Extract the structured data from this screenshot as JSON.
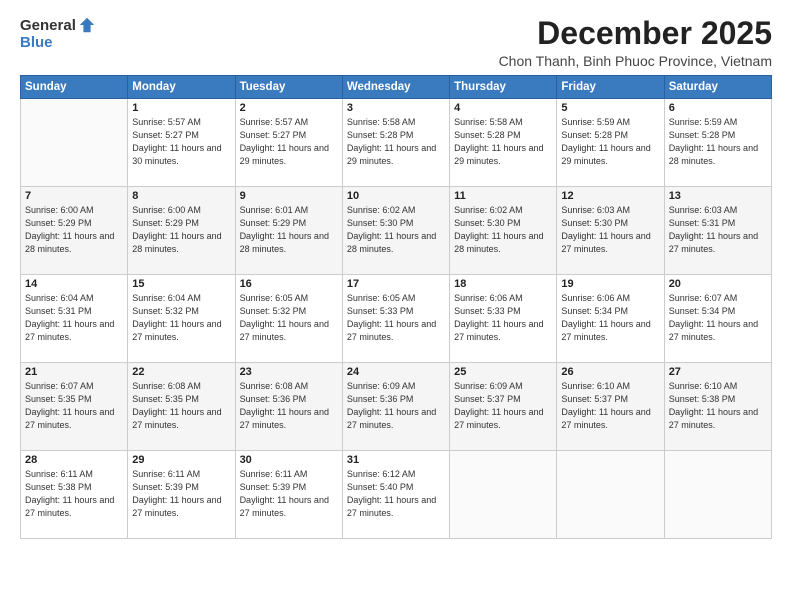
{
  "logo": {
    "general": "General",
    "blue": "Blue"
  },
  "title": "December 2025",
  "subtitle": "Chon Thanh, Binh Phuoc Province, Vietnam",
  "days_of_week": [
    "Sunday",
    "Monday",
    "Tuesday",
    "Wednesday",
    "Thursday",
    "Friday",
    "Saturday"
  ],
  "weeks": [
    [
      {
        "day": "",
        "info": ""
      },
      {
        "day": "1",
        "info": "Sunrise: 5:57 AM\nSunset: 5:27 PM\nDaylight: 11 hours\nand 30 minutes."
      },
      {
        "day": "2",
        "info": "Sunrise: 5:57 AM\nSunset: 5:27 PM\nDaylight: 11 hours\nand 29 minutes."
      },
      {
        "day": "3",
        "info": "Sunrise: 5:58 AM\nSunset: 5:28 PM\nDaylight: 11 hours\nand 29 minutes."
      },
      {
        "day": "4",
        "info": "Sunrise: 5:58 AM\nSunset: 5:28 PM\nDaylight: 11 hours\nand 29 minutes."
      },
      {
        "day": "5",
        "info": "Sunrise: 5:59 AM\nSunset: 5:28 PM\nDaylight: 11 hours\nand 29 minutes."
      },
      {
        "day": "6",
        "info": "Sunrise: 5:59 AM\nSunset: 5:28 PM\nDaylight: 11 hours\nand 28 minutes."
      }
    ],
    [
      {
        "day": "7",
        "info": "Sunrise: 6:00 AM\nSunset: 5:29 PM\nDaylight: 11 hours\nand 28 minutes."
      },
      {
        "day": "8",
        "info": "Sunrise: 6:00 AM\nSunset: 5:29 PM\nDaylight: 11 hours\nand 28 minutes."
      },
      {
        "day": "9",
        "info": "Sunrise: 6:01 AM\nSunset: 5:29 PM\nDaylight: 11 hours\nand 28 minutes."
      },
      {
        "day": "10",
        "info": "Sunrise: 6:02 AM\nSunset: 5:30 PM\nDaylight: 11 hours\nand 28 minutes."
      },
      {
        "day": "11",
        "info": "Sunrise: 6:02 AM\nSunset: 5:30 PM\nDaylight: 11 hours\nand 28 minutes."
      },
      {
        "day": "12",
        "info": "Sunrise: 6:03 AM\nSunset: 5:30 PM\nDaylight: 11 hours\nand 27 minutes."
      },
      {
        "day": "13",
        "info": "Sunrise: 6:03 AM\nSunset: 5:31 PM\nDaylight: 11 hours\nand 27 minutes."
      }
    ],
    [
      {
        "day": "14",
        "info": "Sunrise: 6:04 AM\nSunset: 5:31 PM\nDaylight: 11 hours\nand 27 minutes."
      },
      {
        "day": "15",
        "info": "Sunrise: 6:04 AM\nSunset: 5:32 PM\nDaylight: 11 hours\nand 27 minutes."
      },
      {
        "day": "16",
        "info": "Sunrise: 6:05 AM\nSunset: 5:32 PM\nDaylight: 11 hours\nand 27 minutes."
      },
      {
        "day": "17",
        "info": "Sunrise: 6:05 AM\nSunset: 5:33 PM\nDaylight: 11 hours\nand 27 minutes."
      },
      {
        "day": "18",
        "info": "Sunrise: 6:06 AM\nSunset: 5:33 PM\nDaylight: 11 hours\nand 27 minutes."
      },
      {
        "day": "19",
        "info": "Sunrise: 6:06 AM\nSunset: 5:34 PM\nDaylight: 11 hours\nand 27 minutes."
      },
      {
        "day": "20",
        "info": "Sunrise: 6:07 AM\nSunset: 5:34 PM\nDaylight: 11 hours\nand 27 minutes."
      }
    ],
    [
      {
        "day": "21",
        "info": "Sunrise: 6:07 AM\nSunset: 5:35 PM\nDaylight: 11 hours\nand 27 minutes."
      },
      {
        "day": "22",
        "info": "Sunrise: 6:08 AM\nSunset: 5:35 PM\nDaylight: 11 hours\nand 27 minutes."
      },
      {
        "day": "23",
        "info": "Sunrise: 6:08 AM\nSunset: 5:36 PM\nDaylight: 11 hours\nand 27 minutes."
      },
      {
        "day": "24",
        "info": "Sunrise: 6:09 AM\nSunset: 5:36 PM\nDaylight: 11 hours\nand 27 minutes."
      },
      {
        "day": "25",
        "info": "Sunrise: 6:09 AM\nSunset: 5:37 PM\nDaylight: 11 hours\nand 27 minutes."
      },
      {
        "day": "26",
        "info": "Sunrise: 6:10 AM\nSunset: 5:37 PM\nDaylight: 11 hours\nand 27 minutes."
      },
      {
        "day": "27",
        "info": "Sunrise: 6:10 AM\nSunset: 5:38 PM\nDaylight: 11 hours\nand 27 minutes."
      }
    ],
    [
      {
        "day": "28",
        "info": "Sunrise: 6:11 AM\nSunset: 5:38 PM\nDaylight: 11 hours\nand 27 minutes."
      },
      {
        "day": "29",
        "info": "Sunrise: 6:11 AM\nSunset: 5:39 PM\nDaylight: 11 hours\nand 27 minutes."
      },
      {
        "day": "30",
        "info": "Sunrise: 6:11 AM\nSunset: 5:39 PM\nDaylight: 11 hours\nand 27 minutes."
      },
      {
        "day": "31",
        "info": "Sunrise: 6:12 AM\nSunset: 5:40 PM\nDaylight: 11 hours\nand 27 minutes."
      },
      {
        "day": "",
        "info": ""
      },
      {
        "day": "",
        "info": ""
      },
      {
        "day": "",
        "info": ""
      }
    ]
  ]
}
